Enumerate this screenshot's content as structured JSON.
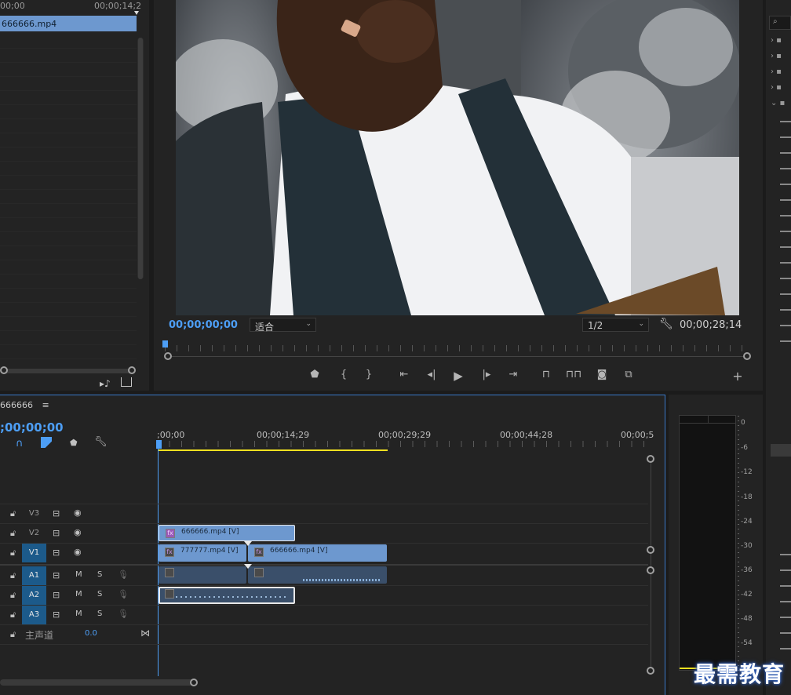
{
  "source": {
    "ruler": {
      "start": "00;00",
      "end": "00;00;14;2"
    },
    "clip_name": "666666.mp4"
  },
  "program": {
    "current_time": "00;00;00;00",
    "fit_label": "适合",
    "resolution": "1/2",
    "duration": "00;00;28;14"
  },
  "timeline": {
    "sequence_name": "666666",
    "menu_glyph": "≡",
    "current_time": ";00;00;00",
    "ruler_labels": [
      ";00;00",
      "00;00;14;29",
      "00;00;29;29",
      "00;00;44;28",
      "00;00;5"
    ],
    "tracks": {
      "video": [
        "V3",
        "V2",
        "V1"
      ],
      "audio": [
        "A1",
        "A2",
        "A3"
      ],
      "mute_label": "M",
      "solo_label": "S"
    },
    "master": {
      "label": "主声道",
      "value": "0.0"
    },
    "clips": {
      "v2": "666666.mp4 [V]",
      "v1_a": "777777.mp4 [V]",
      "v1_b": "666666.mp4 [V]"
    }
  },
  "meter": {
    "labels": [
      "0",
      "-6",
      "-12",
      "-18",
      "-24",
      "-30",
      "-36",
      "-42",
      "-48",
      "-54"
    ]
  },
  "watermark": "最需教育",
  "colors": {
    "accent_blue": "#4d9ef5",
    "clip_video": "#6d98cf",
    "clip_audio": "#3a4f6a",
    "track_on": "#1c5a8a",
    "work_area": "#f0e020"
  }
}
